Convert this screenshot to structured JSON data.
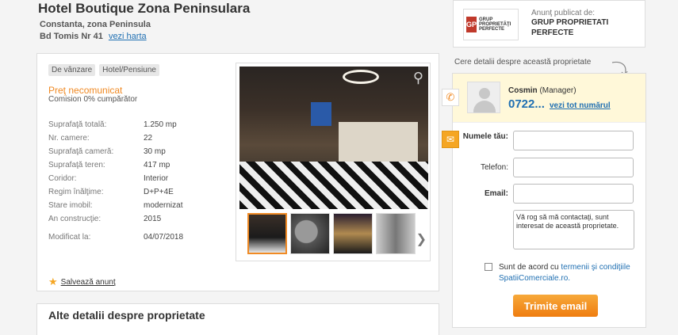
{
  "listing": {
    "title": "Hotel Boutique Zona Peninsulara",
    "city": "Constanta, zona Peninsula",
    "street": "Bd Tomis Nr 41",
    "map_link": "vezi harta",
    "tags": [
      "De vânzare",
      "Hotel/Pensiune"
    ],
    "price": "Preţ necomunicat",
    "commission": "Comision 0% cumpărător",
    "specs": [
      {
        "label": "Suprafaţă totală:",
        "value": "1.250 mp"
      },
      {
        "label": "Nr. camere:",
        "value": "22"
      },
      {
        "label": "Suprafaţă cameră:",
        "value": "30 mp"
      },
      {
        "label": "Suprafaţă teren:",
        "value": "417 mp"
      },
      {
        "label": "Coridor:",
        "value": "Interior"
      },
      {
        "label": "Regim înălţime:",
        "value": "D+P+4E"
      },
      {
        "label": "Stare imobil:",
        "value": "modernizat"
      },
      {
        "label": "An construcţie:",
        "value": "2015"
      }
    ],
    "modified_label": "Modificat la:",
    "modified_value": "04/07/2018",
    "save_label": "Salvează anunţ",
    "details_heading": "Alte detalii despre proprietate"
  },
  "agency": {
    "published_by": "Anunţ publicat de:",
    "name": "GRUP PROPRIETATI PERFECTE",
    "logo_mark": "GP",
    "logo_text": "Grup Proprietăţi Perfecte"
  },
  "contact": {
    "ask_label": "Cere detalii despre această proprietate",
    "agent_name": "Cosmin",
    "agent_role": "(Manager)",
    "phone_prefix": "0722...",
    "show_number": "vezi tot numărul",
    "name_label": "Numele tău:",
    "phone_label": "Telefon:",
    "email_label": "Email:",
    "message": "Vă rog să mă contactaţi, sunt interesat de această proprietate.",
    "agree_text": "Sunt de acord cu ",
    "agree_link": "termenii şi condiţiile SpatiiComerciale.ro.",
    "submit": "Trimite email"
  },
  "icons": [
    "search-zoom-icon",
    "chevron-right-icon",
    "star-icon",
    "phone-icon",
    "mail-icon",
    "user-avatar-icon"
  ],
  "colors": {
    "accent": "#f08a24",
    "link": "#1f6fb2",
    "agent_bg": "#fff8d9"
  }
}
